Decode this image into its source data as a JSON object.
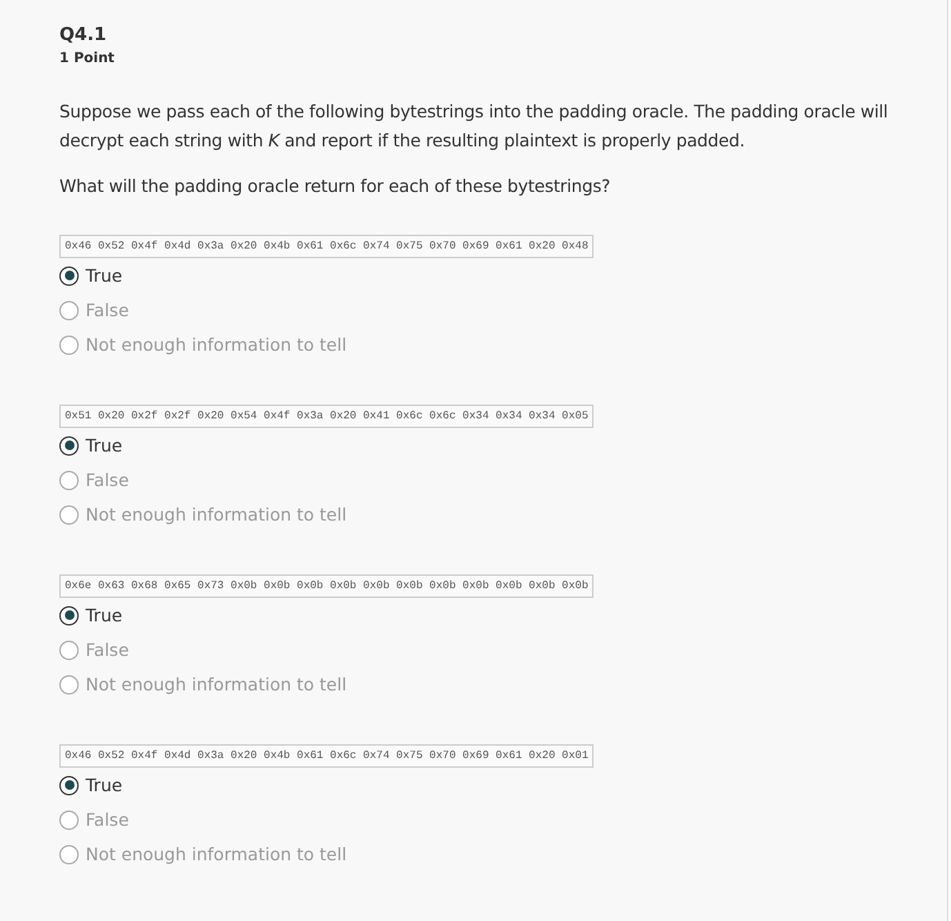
{
  "question": {
    "title": "Q4.1",
    "points": "1 Point",
    "prompt": "Suppose we pass each of the following bytestrings into the padding oracle. The padding oracle will decrypt each string with *K* and report if the resulting plaintext is properly padded.",
    "subprompt": "What will the padding oracle return for each of these bytestrings?"
  },
  "parts": [
    {
      "bytes": "0x46 0x52 0x4f 0x4d 0x3a 0x20 0x4b 0x61 0x6c 0x74 0x75 0x70 0x69 0x61 0x20 0x48",
      "options": [
        {
          "label": "True",
          "selected": true
        },
        {
          "label": "False",
          "selected": false
        },
        {
          "label": "Not enough information to tell",
          "selected": false
        }
      ]
    },
    {
      "bytes": "0x51 0x20 0x2f 0x2f 0x20 0x54 0x4f 0x3a 0x20 0x41 0x6c 0x6c 0x34 0x34 0x34 0x05",
      "options": [
        {
          "label": "True",
          "selected": true
        },
        {
          "label": "False",
          "selected": false
        },
        {
          "label": "Not enough information to tell",
          "selected": false
        }
      ]
    },
    {
      "bytes": "0x6e 0x63 0x68 0x65 0x73 0x0b 0x0b 0x0b 0x0b 0x0b 0x0b 0x0b 0x0b 0x0b 0x0b 0x0b",
      "options": [
        {
          "label": "True",
          "selected": true
        },
        {
          "label": "False",
          "selected": false
        },
        {
          "label": "Not enough information to tell",
          "selected": false
        }
      ]
    },
    {
      "bytes": "0x46 0x52 0x4f 0x4d 0x3a 0x20 0x4b 0x61 0x6c 0x74 0x75 0x70 0x69 0x61 0x20 0x01",
      "options": [
        {
          "label": "True",
          "selected": true
        },
        {
          "label": "False",
          "selected": false
        },
        {
          "label": "Not enough information to tell",
          "selected": false
        }
      ]
    }
  ]
}
